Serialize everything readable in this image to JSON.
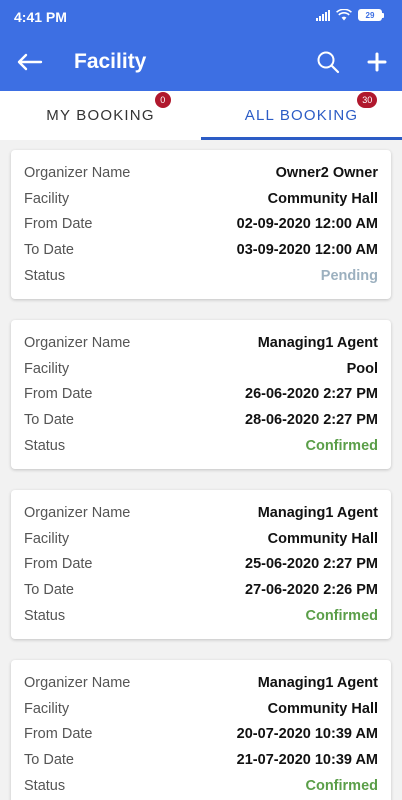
{
  "status_bar": {
    "time": "4:41 PM",
    "battery": "29"
  },
  "header": {
    "title": "Facility",
    "back_icon": "arrow-left-icon",
    "search_icon": "search-icon",
    "add_icon": "plus-icon"
  },
  "tabs": [
    {
      "label": "MY BOOKING",
      "count": "0",
      "active": false
    },
    {
      "label": "ALL BOOKING",
      "count": "30",
      "active": true
    }
  ],
  "field_labels": {
    "organizer": "Organizer Name",
    "facility": "Facility",
    "from": "From Date",
    "to": "To Date",
    "status": "Status"
  },
  "status_colors": {
    "Pending": "#9cb0bf",
    "Confirmed": "#5a9e48"
  },
  "bookings": [
    {
      "organizer": "Owner2 Owner",
      "facility": "Community Hall",
      "from": "02-09-2020 12:00 AM",
      "to": "03-09-2020 12:00 AM",
      "status": "Pending"
    },
    {
      "organizer": "Managing1 Agent",
      "facility": "Pool",
      "from": "26-06-2020 2:27 PM",
      "to": "28-06-2020 2:27 PM",
      "status": "Confirmed"
    },
    {
      "organizer": "Managing1 Agent",
      "facility": "Community Hall",
      "from": "25-06-2020 2:27 PM",
      "to": "27-06-2020 2:26 PM",
      "status": "Confirmed"
    },
    {
      "organizer": "Managing1 Agent",
      "facility": "Community Hall",
      "from": "20-07-2020 10:39 AM",
      "to": "21-07-2020 10:39 AM",
      "status": "Confirmed"
    }
  ]
}
